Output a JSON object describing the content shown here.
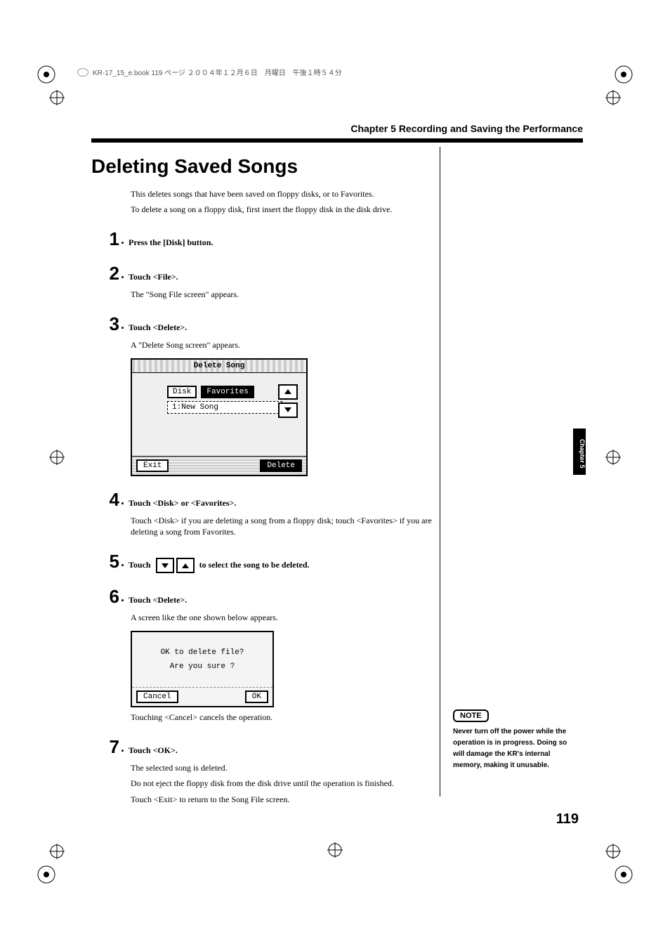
{
  "header_line": "KR-17_15_e.book  119 ページ  ２００４年１２月６日　月曜日　午後１時５４分",
  "chapter_title": "Chapter 5 Recording and Saving the Performance",
  "section_title": "Deleting Saved Songs",
  "intro": [
    "This deletes songs that have been saved on floppy disks, or to Favorites.",
    "To delete a song on a floppy disk, first insert the floppy disk in the disk drive."
  ],
  "steps": [
    {
      "num": "1",
      "instr": "Press the [Disk] button."
    },
    {
      "num": "2",
      "instr": "Touch <File>.",
      "sub": "The \"Song File screen\" appears."
    },
    {
      "num": "3",
      "instr": "Touch <Delete>.",
      "sub": "A \"Delete Song screen\" appears."
    },
    {
      "num": "4",
      "instr": "Touch <Disk> or <Favorites>.",
      "sub": "Touch <Disk> if you are deleting a song from a floppy disk; touch <Favorites> if you are deleting a song from Favorites."
    },
    {
      "num": "5",
      "instr_pre": "Touch ",
      "instr_post": " to select the song to be deleted.",
      "arrows": true
    },
    {
      "num": "6",
      "instr": "Touch <Delete>.",
      "sub": "A screen like the one shown below appears."
    },
    {
      "num": "7",
      "instr": "Touch <OK>.",
      "subs": [
        "The selected song is deleted.",
        "Do not eject the floppy disk from the disk drive until the operation is finished.",
        "Touch <Exit> to return to the Song File screen."
      ]
    }
  ],
  "cancel_note": "Touching <Cancel> cancels the operation.",
  "screenshot1": {
    "title": "Delete Song",
    "tab_disk": "Disk",
    "tab_fav": "Favorites",
    "song": "1:New Song",
    "exit": "Exit",
    "delete": "Delete"
  },
  "dialog": {
    "line1": "OK to delete file?",
    "line2": "Are you sure ?",
    "cancel": "Cancel",
    "ok": "OK"
  },
  "note_label": "NOTE",
  "note_text": "Never turn off the power while the operation is in progress. Doing so will damage the KR's internal memory, making it unusable.",
  "side_tab": "Chapter 5",
  "page_number": "119"
}
